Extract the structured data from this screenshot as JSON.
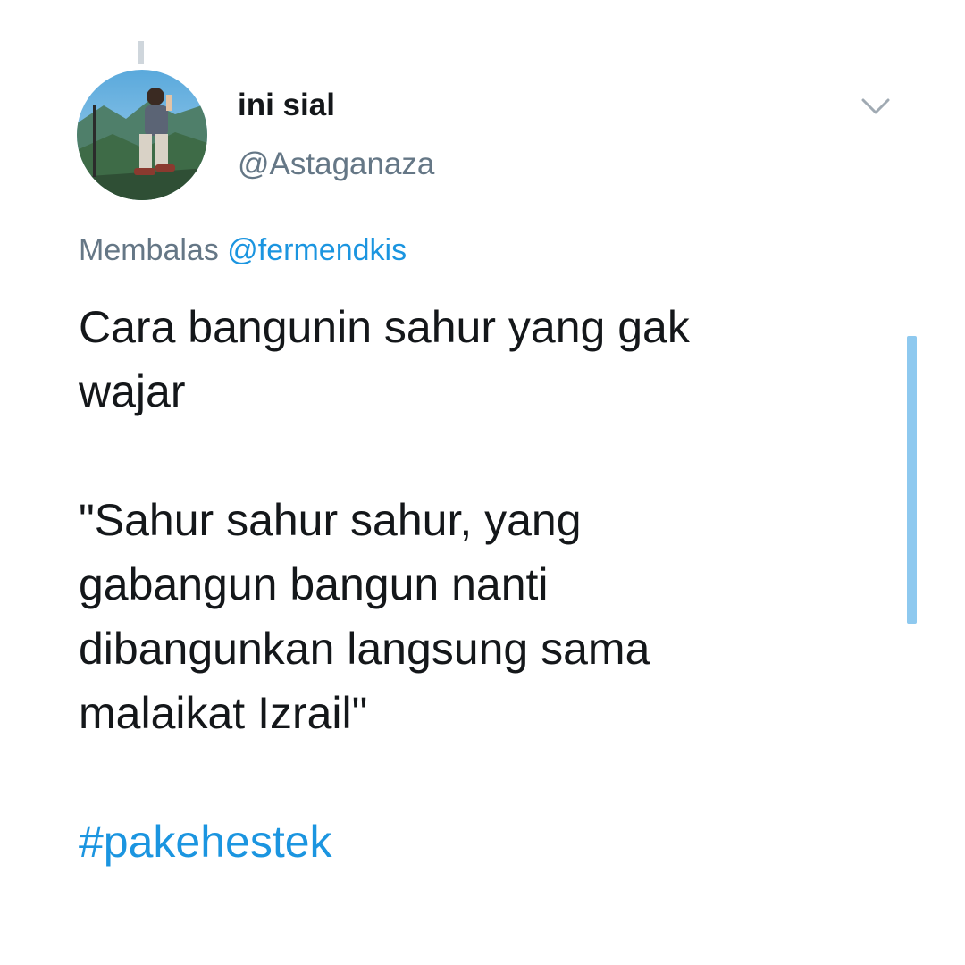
{
  "tweet": {
    "display_name": "ini sial",
    "handle": "@Astaganaza",
    "reply_prefix": "Membalas",
    "reply_mention": "@fermendkis",
    "text_line_1": "Cara bangunin sahur yang gak",
    "text_line_2": "wajar",
    "text_line_3": "\"Sahur sahur sahur, yang",
    "text_line_4": "gabangun bangun nanti",
    "text_line_5": "dibangunkan langsung sama",
    "text_line_6": "malaikat Izrail\"",
    "hashtag": "#pakehestek"
  },
  "icons": {
    "menu": "chevron-down-icon",
    "avatar": "avatar-photo"
  },
  "colors": {
    "text": "#14171a",
    "secondary": "#657786",
    "link": "#1b95e0",
    "scrollbar": "#8ec9ef"
  }
}
